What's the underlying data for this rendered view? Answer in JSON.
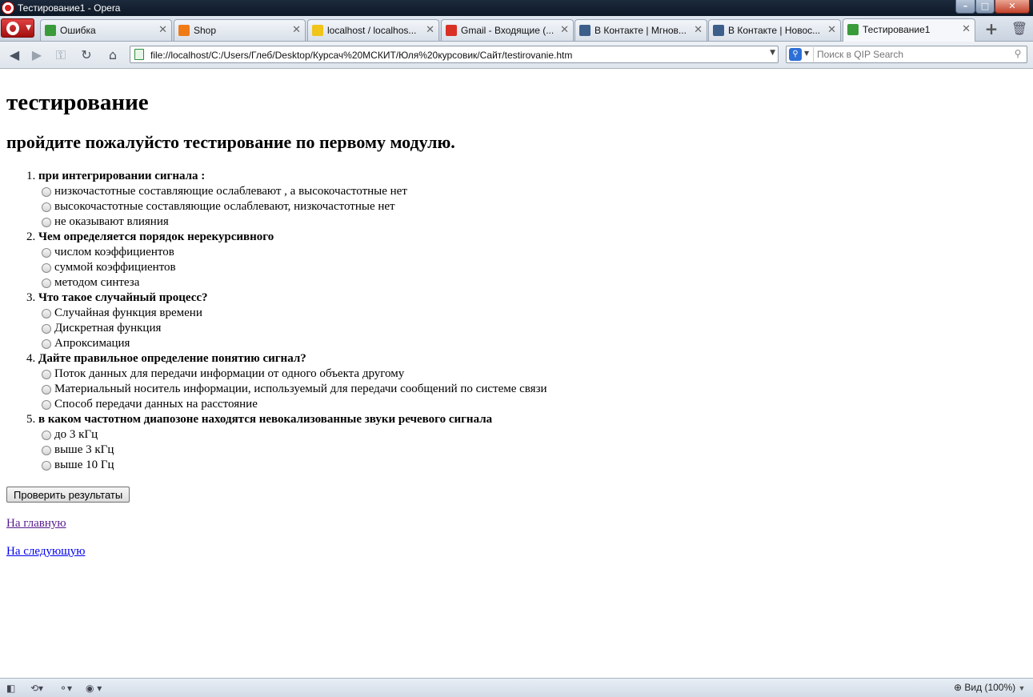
{
  "window": {
    "title": "Тестирование1 - Opera"
  },
  "tabs": [
    {
      "label": "Ошибка",
      "icon": "page-icon",
      "color": "#3a9b3a"
    },
    {
      "label": "Shop",
      "icon": "xampp-icon",
      "color": "#f07a16"
    },
    {
      "label": "localhost / localhos...",
      "icon": "phpmyadmin-icon",
      "color": "#f0c419"
    },
    {
      "label": "Gmail - Входящие (...",
      "icon": "gmail-icon",
      "color": "#d93025"
    },
    {
      "label": "В Контакте | Мгнов...",
      "icon": "vk-chat-icon",
      "color": "#3b5f8a"
    },
    {
      "label": "В Контакте | Новос...",
      "icon": "vk-icon",
      "color": "#3b5f8a"
    },
    {
      "label": "Тестирование1",
      "icon": "page-icon",
      "color": "#3a9b3a"
    }
  ],
  "address": {
    "url": "file://localhost/C:/Users/Глеб/Desktop/Курсач%20МСКИТ/Юля%20курсовик/Сайт/testirovanie.htm"
  },
  "search": {
    "placeholder": "Поиск в QIP Search"
  },
  "page": {
    "heading": "тестирование",
    "subheading": "пройдите пожалуйсто тестирование по первому модулю.",
    "questions": [
      {
        "text": "при интегрировании сигнала :",
        "options": [
          "низкочастотные составляющие ослаблевают , а высокочастотные нет",
          "высокочастотные составляющие ослаблевают, низкочастотные нет",
          "не оказывают влияния"
        ]
      },
      {
        "text": "Чем определяется порядок нерекурсивного",
        "options": [
          "числом коэффициентов",
          "суммой коэффициентов",
          "методом синтеза"
        ]
      },
      {
        "text": "Что такое случайный процесс?",
        "options": [
          "Случайная функция времени",
          "Дискретная функция",
          "Апроксимация"
        ]
      },
      {
        "text": "Дайте правильное определение понятию сигнал?",
        "options": [
          "Поток данных для передачи информации от одного объекта другому",
          "Материальный носитель информации, используемый для передачи сообщений по системе связи",
          "Способ передачи данных на расстояние"
        ]
      },
      {
        "text": "в каком частотном диапозоне находятся невокализованные звуки речевого сигнала",
        "options": [
          "до 3 кГц",
          "выше 3 кГц",
          "выше 10 Гц"
        ]
      }
    ],
    "check_button": "Проверить результаты",
    "link_home": "На главную",
    "link_next": "На следующую"
  },
  "status": {
    "zoom": "Вид (100%)"
  }
}
